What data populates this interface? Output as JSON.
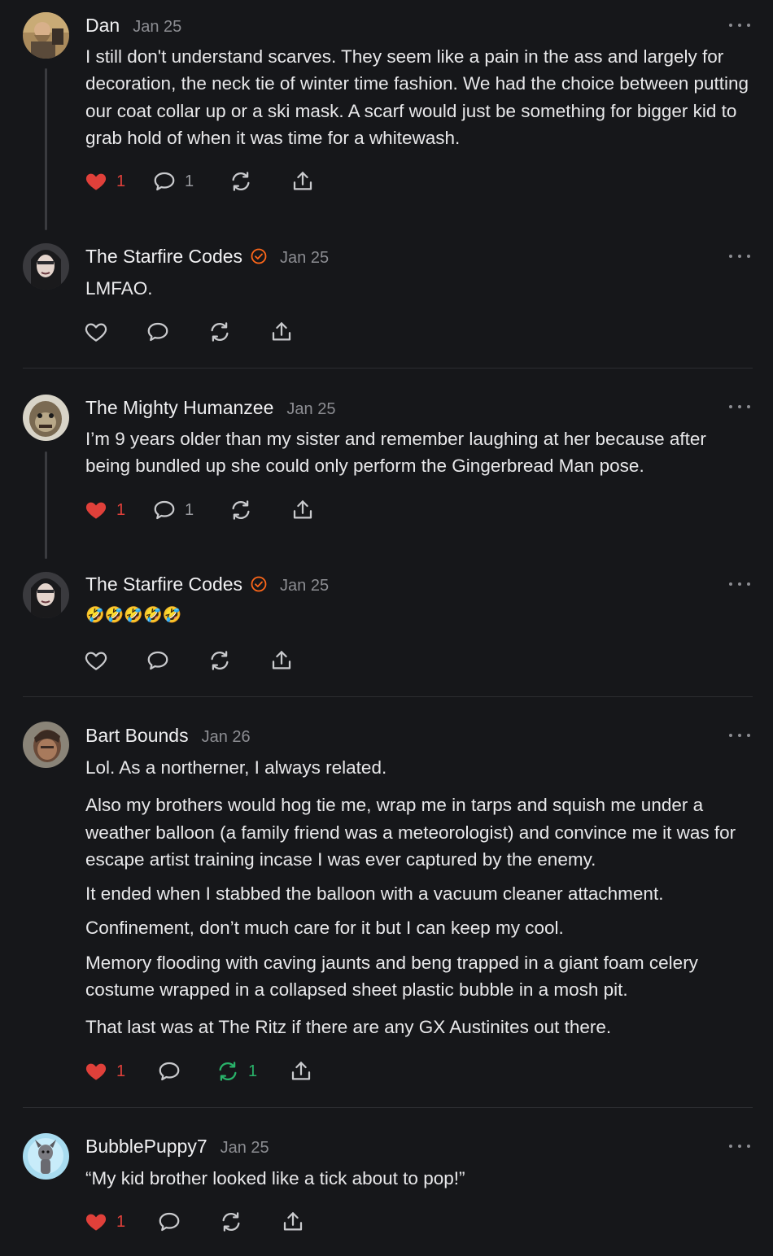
{
  "comments": [
    {
      "author": "Dan",
      "date": "Jan 25",
      "paragraphs": [
        "I still don't understand scarves. They seem like a pain in the ass and largely for decoration, the neck tie of winter time fashion. We had the choice between putting our coat collar up or a ski mask. A scarf would just be something for bigger kid to grab hold of when it was time for a whitewash."
      ],
      "likes": "1",
      "replies": "1"
    },
    {
      "author": "The Starfire Codes",
      "date": "Jan 25",
      "paragraphs": [
        "LMFAO."
      ]
    },
    {
      "author": "The Mighty Humanzee",
      "date": "Jan 25",
      "paragraphs": [
        "I’m 9 years older than my sister and remember laughing at her because after being bundled up she could only perform the Gingerbread Man pose."
      ],
      "likes": "1",
      "replies": "1"
    },
    {
      "author": "The Starfire Codes",
      "date": "Jan 25",
      "paragraphs": [
        "🤣🤣🤣🤣🤣"
      ]
    },
    {
      "author": "Bart Bounds",
      "date": "Jan 26",
      "paragraphs": [
        "Lol. As a northerner, I always related.",
        "Also my brothers would hog tie me, wrap me in tarps and squish me under a weather balloon (a family friend was a meteorologist) and convince me it was for escape artist training incase I was ever captured by the enemy.",
        "It ended when I stabbed the balloon with a vacuum cleaner attachment.",
        "Confinement, don’t much care for it but I can keep my cool.",
        "Memory flooding with caving jaunts and beng trapped in a giant foam celery costume wrapped in a collapsed sheet plastic bubble in a mosh pit.",
        "That last was at The Ritz if there are any GX Austinites out there."
      ],
      "likes": "1",
      "restacks": "1"
    },
    {
      "author": "BubblePuppy7",
      "date": "Jan 25",
      "paragraphs": [
        "“My kid brother looked like a tick about to pop!”"
      ],
      "likes": "1"
    }
  ],
  "icons": {
    "like": "heart-icon",
    "reply": "comment-bubble-icon",
    "restack": "restack-icon",
    "share": "share-icon",
    "more": "more-dots-icon",
    "verified": "verified-badge-icon"
  },
  "colors": {
    "background": "#16171a",
    "like_active": "#e0403a",
    "restack_active": "#29b36a",
    "verified": "#ff6719",
    "muted": "#8c8d92"
  }
}
